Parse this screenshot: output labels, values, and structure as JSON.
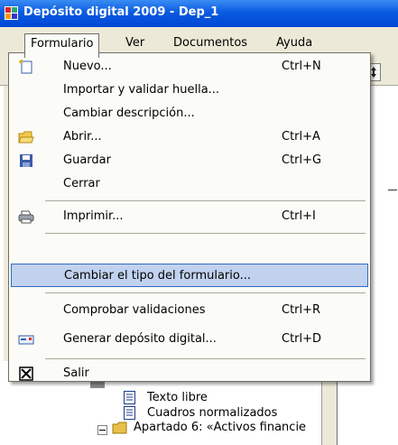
{
  "window": {
    "title": "Depósito digital 2009 - Dep_1"
  },
  "menubar": {
    "items": [
      {
        "label": "Formulario"
      },
      {
        "label": "Ver"
      },
      {
        "label": "Documentos"
      },
      {
        "label": "Ayuda"
      }
    ]
  },
  "dropdown": {
    "items": [
      {
        "label": "Nuevo...",
        "shortcut": "Ctrl+N",
        "icon": "new-document-icon"
      },
      {
        "label": "Importar y validar huella...",
        "shortcut": ""
      },
      {
        "label": "Cambiar descripción...",
        "shortcut": ""
      },
      {
        "label": "Abrir...",
        "shortcut": "Ctrl+A",
        "icon": "open-folder-icon"
      },
      {
        "label": "Guardar",
        "shortcut": "Ctrl+G",
        "icon": "save-icon"
      },
      {
        "label": "Cerrar",
        "shortcut": ""
      },
      {
        "label": "Imprimir...",
        "shortcut": "Ctrl+I",
        "icon": "printer-icon"
      },
      {
        "label": "Cambiar el tipo del formulario...",
        "shortcut": ""
      },
      {
        "label": "Comprobar validaciones",
        "shortcut": "Ctrl+R"
      },
      {
        "label": "Generar depósito digital...",
        "shortcut": "Ctrl+D",
        "icon": "card-icon"
      },
      {
        "label": "Salir",
        "shortcut": "",
        "icon": "close-box-icon"
      }
    ],
    "highlighted": "Cambiar el tipo del formulario..."
  },
  "tree": {
    "items": [
      {
        "label": "Texto libre",
        "icon": "document-icon"
      },
      {
        "label": "Cuadros normalizados",
        "icon": "document-icon"
      },
      {
        "label": "Apartado 6: «Activos financie",
        "icon": "folder-icon"
      }
    ]
  },
  "colors": {
    "titlebar": "#0a5be0",
    "menu_bg": "#ece9d8",
    "dropdown_bg": "#fbfbf8",
    "highlight_bg": "#c1d2ee",
    "highlight_border": "#316ac5"
  }
}
